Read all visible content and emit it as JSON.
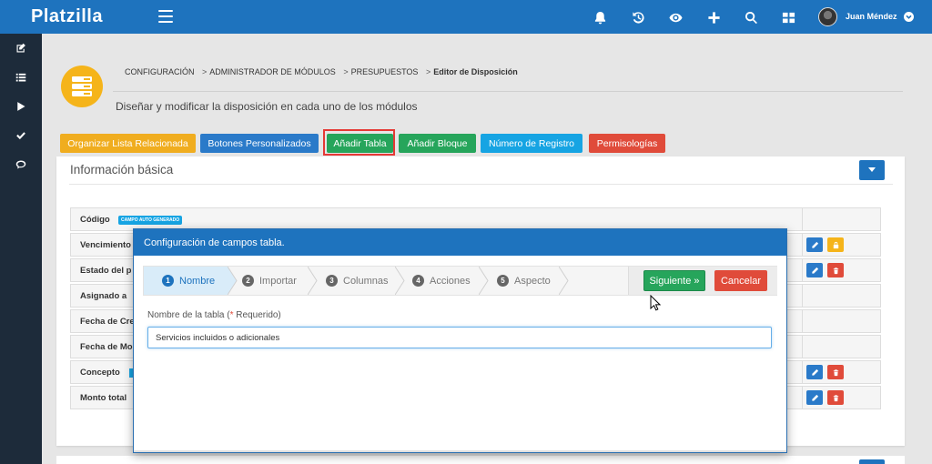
{
  "app": {
    "logo": "Platzilla"
  },
  "user": {
    "name": "Juan Méndez"
  },
  "topbar_icons": [
    "bell-icon",
    "history-icon",
    "eye-icon",
    "plus-icon",
    "search-icon",
    "grid-icon"
  ],
  "sidebar_icons": [
    "edit-icon",
    "list-icon",
    "play-icon",
    "check-icon",
    "chat-icon"
  ],
  "breadcrumb": {
    "items": [
      "CONFIGURACIÓN",
      "ADMINISTRADOR DE MÓDULOS",
      "PRESUPUESTOS",
      "Editor de Disposición"
    ],
    "separator": ">"
  },
  "subtitle": "Diseñar y modificar la disposición en cada uno de los módulos",
  "actions": {
    "organize": "Organizar Lista Relacionada",
    "custom_buttons": "Botones Personalizados",
    "add_table": "Añadir Tabla",
    "add_block": "Añadir Bloque",
    "record_number": "Número de Registro",
    "permissions": "Permisologías"
  },
  "info_panel": {
    "title": "Información básica",
    "auto_badge": "CAMPO AUTO GENERADO",
    "fields": [
      "Código",
      "Vencimiento",
      "Estado del p",
      "Asignado a",
      "Fecha de Cre",
      "Fecha de Mo",
      "Concepto",
      "Monto total"
    ]
  },
  "modal": {
    "title": "Configuración de campos tabla.",
    "steps": [
      {
        "num": "1",
        "label": "Nombre"
      },
      {
        "num": "2",
        "label": "Importar"
      },
      {
        "num": "3",
        "label": "Columnas"
      },
      {
        "num": "4",
        "label": "Acciones"
      },
      {
        "num": "5",
        "label": "Aspecto"
      }
    ],
    "next": "Siguiente »",
    "cancel": "Cancelar",
    "field_label": "Nombre de la tabla (",
    "required_mark": "*",
    "required_text": " Requerido)",
    "input_value": "Servicios incluidos o adicionales"
  },
  "colors": {
    "primary": "#1e73be",
    "sidebar": "#1d2b3a",
    "orange": "#f0ad1f",
    "green": "#26a55b",
    "cyan": "#16a4e3",
    "red": "#e04b3a",
    "module_icon": "#f5b41a"
  }
}
